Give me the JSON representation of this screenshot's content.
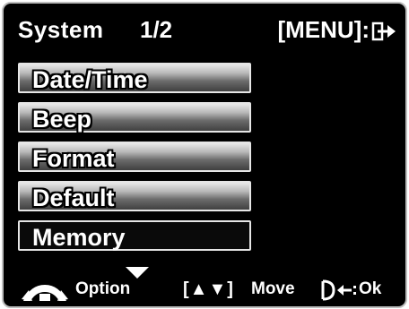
{
  "header": {
    "title": "System",
    "page": "1/2",
    "menu_hint": "[MENU]:",
    "exit_icon": "exit-arrow-icon"
  },
  "menu": {
    "items": [
      {
        "label": "Date/Time"
      },
      {
        "label": "Beep"
      },
      {
        "label": "Format"
      },
      {
        "label": "Default"
      },
      {
        "label": "Memory",
        "selected": true
      }
    ]
  },
  "footer": {
    "scroll_indicator_icon": "down-triangle-icon",
    "option_icon": "mode-dial-icon",
    "option_label": "Option",
    "move_icon": "[▲▼]",
    "move_label": "Move",
    "ok_icon": "shutter-enter-icon",
    "ok_label": "Ok"
  },
  "colors": {
    "background": "#000000",
    "text": "#ffffff",
    "frame": "#bdbdbd"
  }
}
